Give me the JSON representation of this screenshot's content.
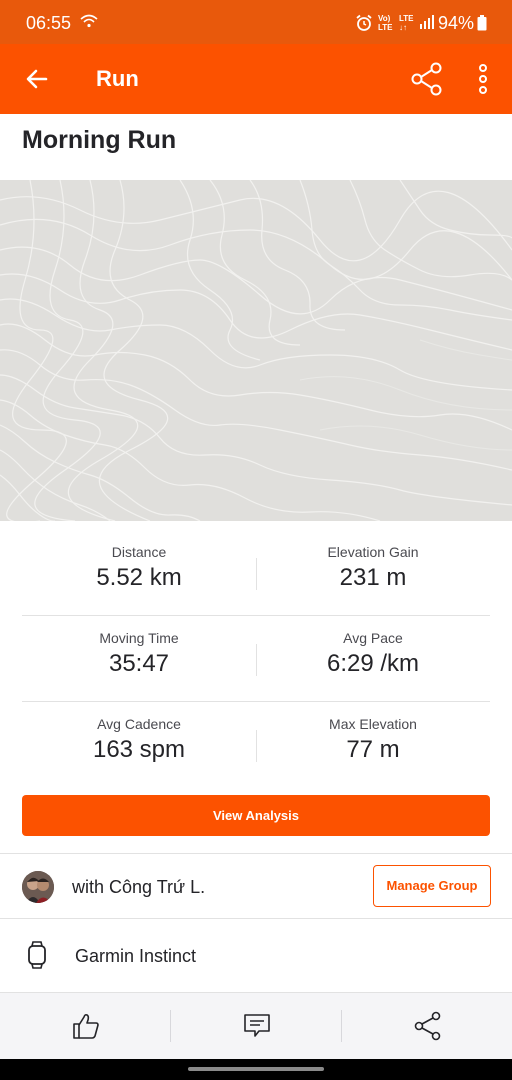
{
  "status_bar": {
    "time": "06:55",
    "lte_top": "Vo)",
    "lte_bottom": "LTE",
    "lte2_top": "LTE",
    "lte2_bottom": "↓↑",
    "battery": "94%"
  },
  "app_bar": {
    "title": "Run",
    "back_icon": "arrow-left-icon",
    "share_icon": "share-icon",
    "more_icon": "more-vertical-icon"
  },
  "activity": {
    "title": "Morning Run"
  },
  "stats": [
    [
      {
        "label": "Distance",
        "value": "5.52 km"
      },
      {
        "label": "Elevation Gain",
        "value": "231 m"
      }
    ],
    [
      {
        "label": "Moving Time",
        "value": "35:47"
      },
      {
        "label": "Avg Pace",
        "value": "6:29 /km"
      }
    ],
    [
      {
        "label": "Avg Cadence",
        "value": "163 spm"
      },
      {
        "label": "Max Elevation",
        "value": "77 m"
      }
    ]
  ],
  "analysis_button": "View Analysis",
  "group": {
    "text": "with Công Trứ L.",
    "manage_label": "Manage Group"
  },
  "device": {
    "name": "Garmin Instinct"
  },
  "bottom_bar": {
    "icons": [
      "thumbs-up-icon",
      "comment-icon",
      "share-icon"
    ]
  },
  "colors": {
    "brand": "#fc5200",
    "status_bar": "#e8590c"
  }
}
